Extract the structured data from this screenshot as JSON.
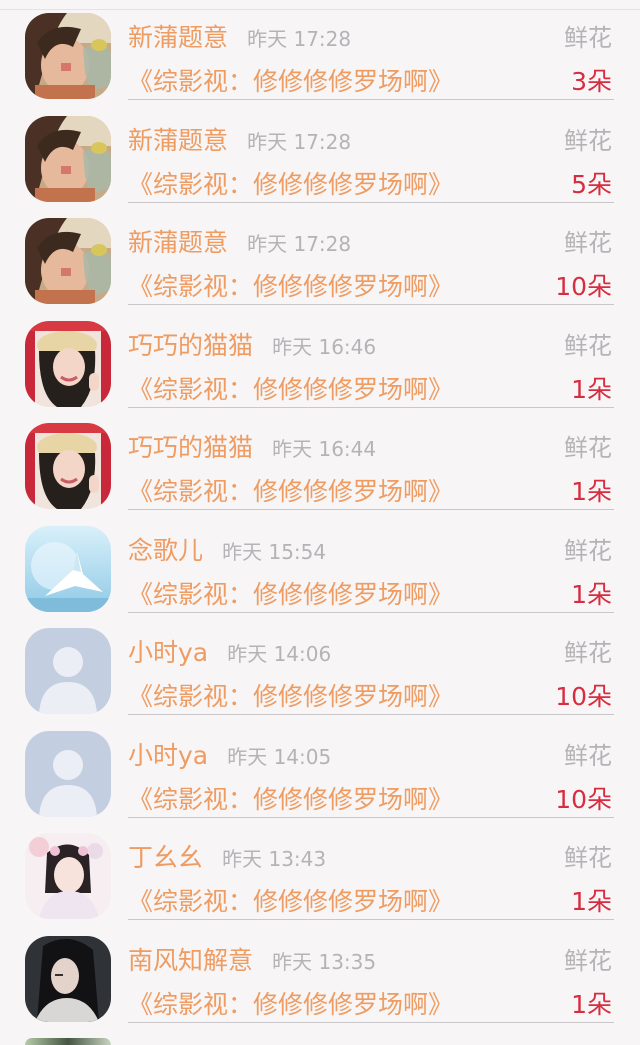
{
  "list": {
    "rows": [
      {
        "name": "新蒲题意",
        "time": "昨天 17:28",
        "gift_type": "鲜花",
        "title": "《综影视：修修修修罗场啊》",
        "count": "3朵",
        "avatar_icon": "girl-drinking-avatar"
      },
      {
        "name": "新蒲题意",
        "time": "昨天 17:28",
        "gift_type": "鲜花",
        "title": "《综影视：修修修修罗场啊》",
        "count": "5朵",
        "avatar_icon": "girl-drinking-avatar"
      },
      {
        "name": "新蒲题意",
        "time": "昨天 17:28",
        "gift_type": "鲜花",
        "title": "《综影视：修修修修罗场啊》",
        "count": "10朵",
        "avatar_icon": "girl-drinking-avatar"
      },
      {
        "name": "巧巧的猫猫",
        "time": "昨天 16:46",
        "gift_type": "鲜花",
        "title": "《综影视：修修修修罗场啊》",
        "count": "1朵",
        "avatar_icon": "woman-with-hat-avatar"
      },
      {
        "name": "巧巧的猫猫",
        "time": "昨天 16:44",
        "gift_type": "鲜花",
        "title": "《综影视：修修修修罗场啊》",
        "count": "1朵",
        "avatar_icon": "woman-with-hat-avatar"
      },
      {
        "name": "念歌儿",
        "time": "昨天 15:54",
        "gift_type": "鲜花",
        "title": "《综影视：修修修修罗场啊》",
        "count": "1朵",
        "avatar_icon": "paper-crane-avatar"
      },
      {
        "name": "小时ya",
        "time": "昨天 14:06",
        "gift_type": "鲜花",
        "title": "《综影视：修修修修罗场啊》",
        "count": "10朵",
        "avatar_icon": "default-user-avatar"
      },
      {
        "name": "小时ya",
        "time": "昨天 14:05",
        "gift_type": "鲜花",
        "title": "《综影视：修修修修罗场啊》",
        "count": "10朵",
        "avatar_icon": "default-user-avatar"
      },
      {
        "name": "丁幺幺",
        "time": "昨天 13:43",
        "gift_type": "鲜花",
        "title": "《综影视：修修修修罗场啊》",
        "count": "1朵",
        "avatar_icon": "costume-woman-avatar"
      },
      {
        "name": "南风知解意",
        "time": "昨天 13:35",
        "gift_type": "鲜花",
        "title": "《综影视：修修修修罗场啊》",
        "count": "1朵",
        "avatar_icon": "dark-haired-woman-avatar"
      }
    ]
  },
  "colors": {
    "name_orange": "#ee9c62",
    "count_red": "#d62e40",
    "meta_gray": "#b5b3b6",
    "background": "#f7f5f6"
  }
}
